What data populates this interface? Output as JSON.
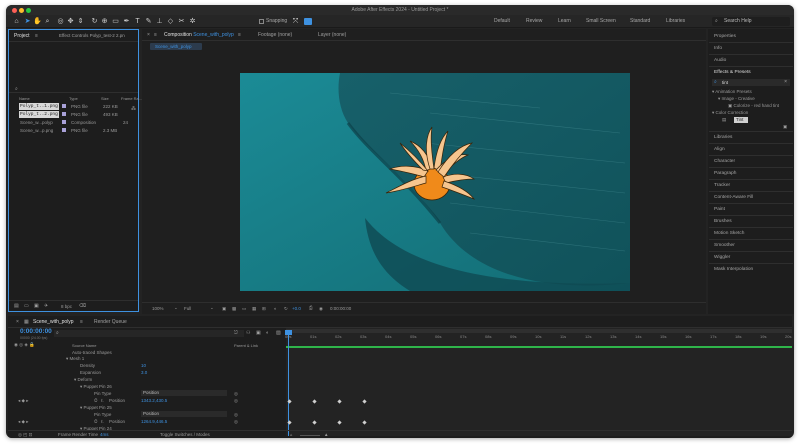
{
  "window": {
    "title": "Adobe After Effects 2024 - Untitled Project *"
  },
  "toolbar": {
    "snapping_label": "Snapping",
    "workspaces": [
      "Default",
      "Review",
      "Learn",
      "Small Screen",
      "Standard",
      "Libraries"
    ],
    "search_help_placeholder": "Search Help"
  },
  "project_panel": {
    "tab_project": "Project",
    "tab_effect_controls": "Effect Controls Polyp_test-2 2.pn",
    "columns": {
      "name": "Name",
      "type": "Type",
      "size": "Size",
      "frame_rate": "Frame Ra..."
    },
    "items": [
      {
        "name": "Polyp_t..1.png",
        "type": "PNG file",
        "size": "222 KB",
        "fr": ""
      },
      {
        "name": "Polyp_t..2.png",
        "type": "PNG file",
        "size": "493 KB",
        "fr": ""
      },
      {
        "name": "Scene_w...polyp",
        "type": "Composition",
        "size": "",
        "fr": "24"
      },
      {
        "name": "Scene_w...p.png",
        "type": "PNG file",
        "size": "2.3 MB",
        "fr": ""
      }
    ],
    "bpc": "8 bpc"
  },
  "composition_panel": {
    "tab_composition_prefix": "Composition",
    "tab_composition_name": "Scene_with_polyp",
    "tab_footage": "Footage (none)",
    "tab_layer": "Layer (none)",
    "comp_subtab": "Scene_with_polyp",
    "zoom": "100%",
    "resolution": "Full",
    "exposure": "+0.0",
    "timecode": "0:00:00:00"
  },
  "right_panel": {
    "items_top": [
      "Properties",
      "Info",
      "Audio"
    ],
    "effects_presets": "Effects & Presets",
    "search_value": "tint",
    "tree": [
      {
        "label": "Animation Presets",
        "indent": 0
      },
      {
        "label": "Image - Creative",
        "indent": 1
      },
      {
        "label": "Colorize - red hand tint",
        "indent": 2
      },
      {
        "label": "Color Correction",
        "indent": 0
      },
      {
        "label": "Tint",
        "indent": 2
      }
    ],
    "items_bottom": [
      "Libraries",
      "Align",
      "Character",
      "Paragraph",
      "Tracker",
      "Content-Aware Fill",
      "Paint",
      "Brushes",
      "Motion Sketch",
      "Smoother",
      "Wiggler",
      "Mask Interpolation"
    ]
  },
  "timeline": {
    "tab_comp": "Scene_with_polyp",
    "tab_render": "Render Queue",
    "timecode": "0:00:00:00",
    "timecode_sub": "00000 (24.00 fps)",
    "col_source": "Source Name",
    "col_parent": "Parent & Link",
    "layers": [
      {
        "label": "Auto-traced Shapes",
        "indent": 0,
        "value": ""
      },
      {
        "label": "Mesh 1",
        "indent": 0,
        "value": ""
      },
      {
        "label": "Density",
        "indent": 1,
        "value": "10"
      },
      {
        "label": "Expansion",
        "indent": 1,
        "value": "3.0"
      },
      {
        "label": "Deform",
        "indent": 1,
        "value": ""
      },
      {
        "label": "Puppet Pin 26",
        "indent": 2,
        "value": ""
      },
      {
        "label": "Pin Type",
        "indent": 3,
        "value": "Position"
      },
      {
        "label": "Position",
        "indent": 3,
        "value": "1343.2,430.5"
      },
      {
        "label": "Puppet Pin 25",
        "indent": 2,
        "value": ""
      },
      {
        "label": "Pin Type",
        "indent": 3,
        "value": "Position"
      },
      {
        "label": "Position",
        "indent": 3,
        "value": "1264.9,446.5"
      },
      {
        "label": "Puppet Pin 24",
        "indent": 2,
        "value": ""
      }
    ],
    "ruler_ticks": [
      "00s",
      "01s",
      "02s",
      "03s",
      "04s",
      "05s",
      "06s",
      "07s",
      "08s",
      "09s",
      "10s",
      "11s",
      "12s",
      "13s",
      "14s",
      "15s",
      "16s",
      "17s",
      "18s",
      "19s",
      "20s"
    ],
    "frame_render_label": "Frame Render Time",
    "frame_render_value": "4ms",
    "toggle_label": "Toggle Switches / Modes"
  },
  "colors": {
    "accent_blue": "#3e91e0",
    "app_bg": "#232323",
    "panel_bg": "#1d1d1d",
    "teal": "#1f7f87",
    "polyp_orange": "#f08a1a",
    "polyp_tentacle": "#f6c58e",
    "work_area_green": "#2fb54a"
  },
  "icons": [
    "apple-menu-icon",
    "home-icon",
    "selection-arrow-icon",
    "hand-icon",
    "zoom-icon",
    "rotate-icon",
    "pen-icon",
    "type-icon",
    "brush-icon",
    "stamp-icon",
    "eraser-icon",
    "roto-icon",
    "puppet-pin-icon",
    "search-icon",
    "camera-icon"
  ]
}
